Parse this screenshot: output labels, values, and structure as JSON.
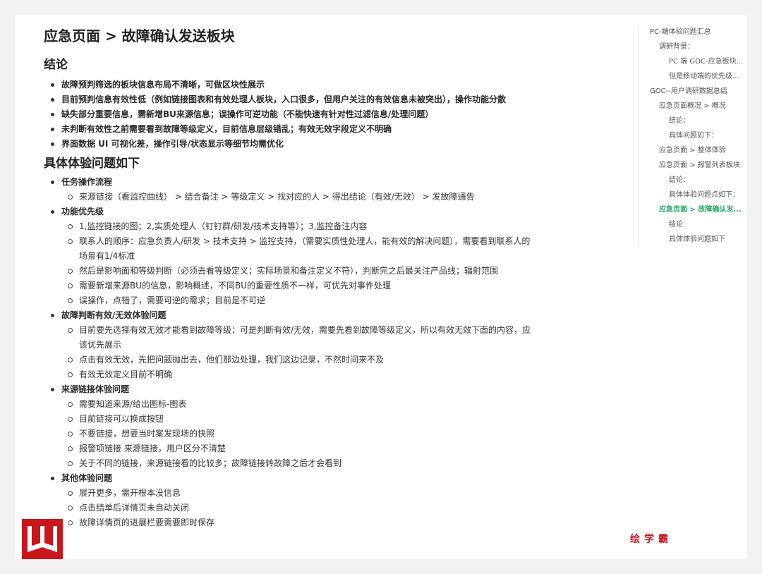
{
  "title": "应急页面 > 故障确认发送板块",
  "conclusion": {
    "heading": "结论",
    "items": [
      "故障预判筛选的板块信息布局不清晰，可做区块性展示",
      "目前预判信息有效性低（例如链接图表和有效处理人板块，入口很多，但用户关注的有效信息未被突出），操作功能分散",
      "缺失部分重要信息，需新增BU来源信息；误操作可逆功能（不能快速有针对性过滤信息/处理问题）",
      "未判断有效性之前需要看到故障等级定义，目前信息层级错乱；有效无效字段定义不明确",
      "界面数据 UI 可视化差，操作引导/状态显示等细节均需优化"
    ]
  },
  "detail": {
    "heading": "具体体验问题如下",
    "groups": [
      {
        "label": "任务操作流程",
        "items": [
          "来源链接（看监控曲线）  > 结合备注 > 等级定义 > 找对应的人 > 得出结论（有效/无效）  > 发故障通告"
        ]
      },
      {
        "label": "功能优先级",
        "items": [
          "1,监控链接的图；2,实质处理人（钉钉群/研发/技术支持等）；3,监控备注内容",
          "联系人的顺序：应急负责人/研发  >  技术支持  >  监控支持，（需要实质性处理人，能有效的解决问题），需要看到联系人的场景有1/4标准",
          "然后是影响面和等级判断（必须去看等级定义；实际场景和备注定义不符），判断完之后最关注产品线；辐射范围",
          "需要新增来源BU的信息，影响概述，不同BU的重要性质不一样，可优先对事件处理",
          "误操作，点错了，需要可逆的需求；目前是不可逆"
        ]
      },
      {
        "label": "故障判断有效/无效体验问题",
        "items": [
          "目前要先选择有效无效才能看到故障等级；可是判断有效/无效，需要先看到故障等级定义，所以有效无效下面的内容，应该优先展示",
          "点击有效无效，先把问题抛出去，他们那边处理，我们这边记录，不然时间来不及",
          "有效无效定义目前不明确"
        ]
      },
      {
        "label": "来源链接体验问题",
        "items": [
          "需要知道来源/给出图标-图表",
          "目前链接可以换成按钮",
          "不要链接，想要当时案发现场的快照",
          "报警项链接  来源链接，用户区分不清楚",
          "关于不同的链接，来源链接看的比较多；故障链接转故障之后才会看到"
        ]
      },
      {
        "label": "其他体验问题",
        "items": [
          "展开更多，需开根本没信息",
          "点击结单后详情页未自动关闭",
          "故障详情页的进展栏要需要即时保存"
        ]
      }
    ]
  },
  "toc": [
    {
      "label": "PC-端体验问题汇总",
      "level": 1
    },
    {
      "label": "调研背景：",
      "level": 2
    },
    {
      "label": "PC 端 GOC-应急板块...",
      "level": 3
    },
    {
      "label": "但是移动端的优先级...",
      "level": 3
    },
    {
      "label": "GOC--用户调研数据总结",
      "level": 1
    },
    {
      "label": "应急页面概况 > 概况",
      "level": 2
    },
    {
      "label": "结论：",
      "level": 3
    },
    {
      "label": "具体问题如下：",
      "level": 3
    },
    {
      "label": "应急页面 > 整体体验",
      "level": 2
    },
    {
      "label": "应急页面 > 报警列表板块",
      "level": 2
    },
    {
      "label": "结论：",
      "level": 3
    },
    {
      "label": "具体体验问题点如下：",
      "level": 3
    },
    {
      "label": "应急页面 > 故障确认发...",
      "level": 2,
      "active": true
    },
    {
      "label": "结论",
      "level": 3
    },
    {
      "label": "具体体验问题如下",
      "level": 3
    }
  ],
  "watermark": {
    "brand": "绘学霸",
    "logo_icon": "stacked-w-logo-icon",
    "colors": {
      "logo": "#c9161d",
      "toc_active": "#29a863"
    }
  }
}
